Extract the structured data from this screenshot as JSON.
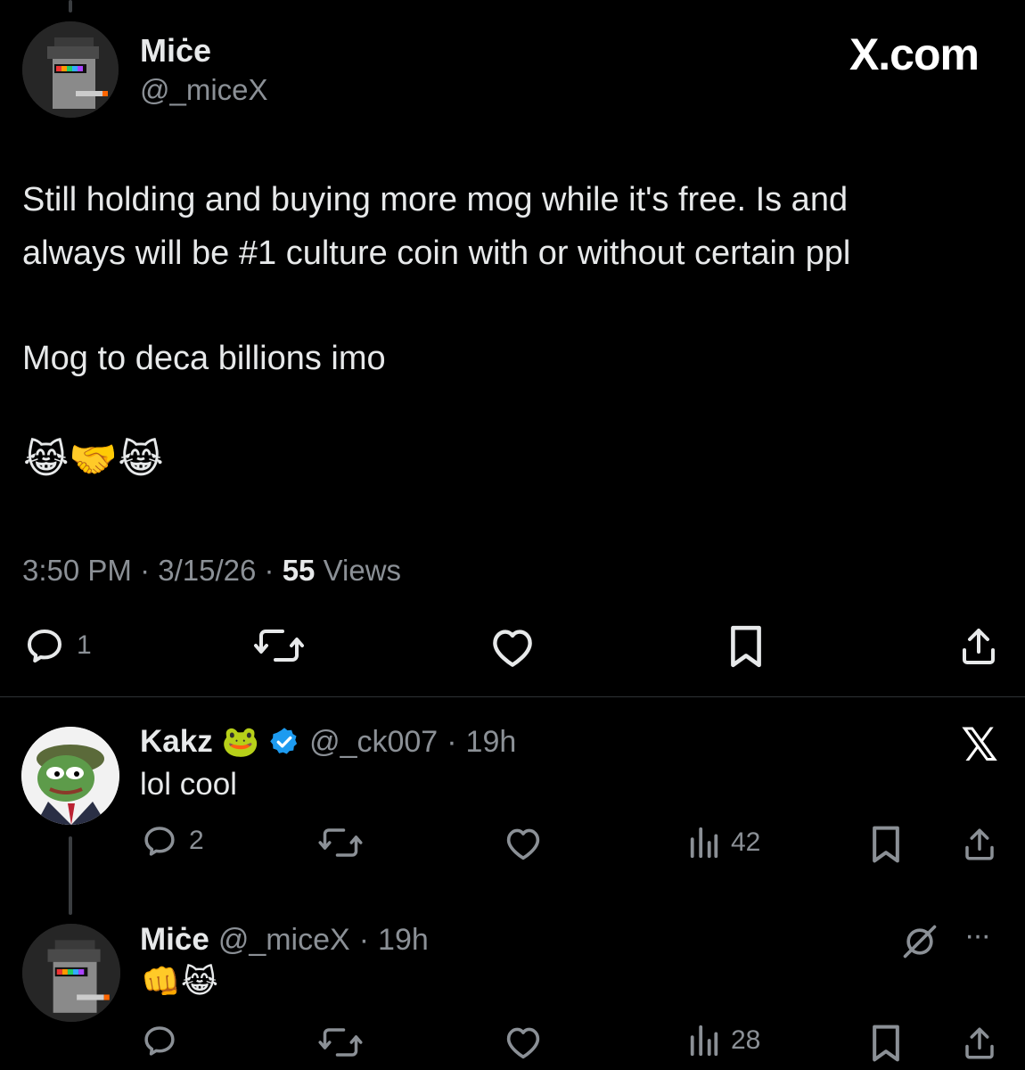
{
  "brand": "X.com",
  "main_tweet": {
    "author_name": "Miċe",
    "author_handle": "@_miceX",
    "text_line1": "Still holding and buying more mog while it's free. Is and",
    "text_line2": "always will be #1 culture coin with or without certain ppl",
    "text_line3": "Mog to deca billions imo",
    "emojis": "😹🤝😹",
    "time": "3:50 PM",
    "date": "3/15/26",
    "views_count": "55",
    "views_label": "Views",
    "sep": "·",
    "reply_count": "1"
  },
  "reply1": {
    "name": "Kakz",
    "name_emoji": "🐸",
    "handle": "@_ck007",
    "sep": "·",
    "age": "19h",
    "text": "lol cool",
    "reply_count": "2",
    "views": "42"
  },
  "reply2": {
    "name": "Miċe",
    "handle": "@_miceX",
    "sep": "·",
    "age": "19h",
    "emojis": "👊😹",
    "views": "28",
    "more": "···"
  },
  "icons": [
    "reply-icon",
    "retweet-icon",
    "like-icon",
    "bookmark-icon",
    "share-icon",
    "views-icon",
    "verified-icon",
    "x-logo-icon",
    "grok-icon",
    "more-icon"
  ]
}
